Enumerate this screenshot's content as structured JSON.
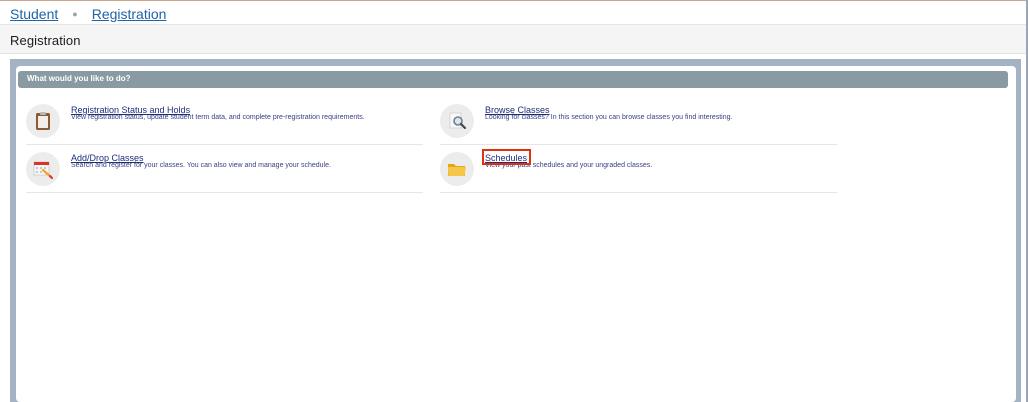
{
  "breadcrumb": {
    "items": [
      "Student",
      "Registration"
    ],
    "separator": "●"
  },
  "page": {
    "title": "Registration"
  },
  "panel": {
    "header": "What would you like to do?"
  },
  "actions": [
    {
      "label": "Registration Status and Holds",
      "description": "View registration status, update student term data, and complete pre-registration requirements.",
      "icon": "clipboard-icon"
    },
    {
      "label": "Browse Classes",
      "description": "Looking for classes? In this section you can browse classes you find interesting.",
      "icon": "magnifier-icon"
    },
    {
      "label": "Add/Drop Classes",
      "description": "Search and register for your classes. You can also view and manage your schedule.",
      "icon": "calendar-pencil-icon"
    },
    {
      "label": "Schedules",
      "description": "View your past schedules and your ungraded classes.",
      "icon": "folder-icon"
    }
  ],
  "colors": {
    "link": "#1f64a8",
    "panel_header": "#8a9aa3",
    "frame": "#a3b3c4",
    "highlight": "#e0310e"
  }
}
